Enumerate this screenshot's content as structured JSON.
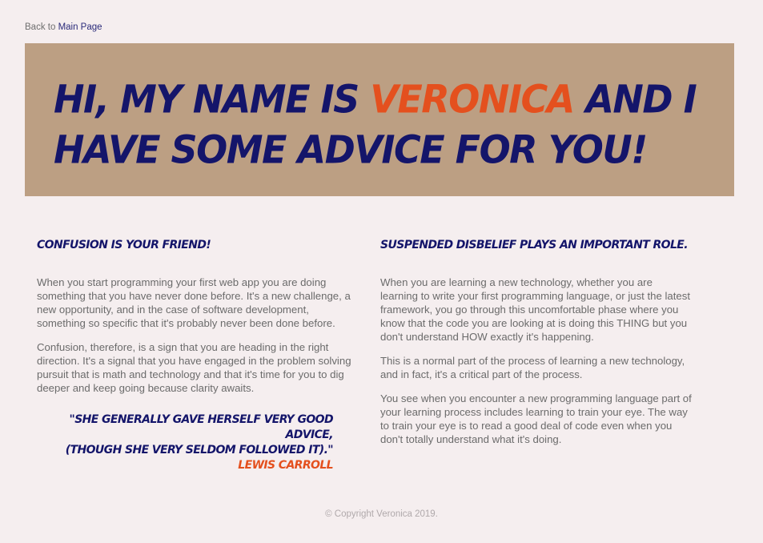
{
  "nav": {
    "back_prefix": "Back to",
    "back_link": "Main Page"
  },
  "hero": {
    "title_before": "Hi, my name is",
    "title_name": "Veronica",
    "title_after": "and I have some advice for you!"
  },
  "left": {
    "heading": "Confusion is your friend!",
    "paragraphs": [
      "When you start programming your first web app you are doing something that you have never done before. It's a new challenge, a new opportunity, and in the case of software development, something so specific that it's probably never been done before.",
      "Confusion, therefore, is a sign that you are heading in the right direction. It's a signal that you have engaged in the problem solving pursuit that is math and technology and that it's time for you to dig deeper and keep going because clarity awaits."
    ],
    "quote": {
      "line1": "\"She generally gave herself very good advice,",
      "line2": "(though she very seldom followed it).\"",
      "author": "Lewis Carroll"
    }
  },
  "right": {
    "heading": "Suspended disbelief plays an important role.",
    "paragraphs": [
      "When you are learning a new technology, whether you are learning to write your first programming language, or just the latest framework, you go through this uncomfortable phase where you know that the code you are looking at is doing this THING but you don't understand HOW exactly it's happening.",
      "This is a normal part of the process of learning a new technology, and in fact, it's a critical part of the process.",
      "You see when you encounter a new programming language part of your learning process includes learning to train your eye. The way to train your eye is to read a good deal of code even when you don't totally understand what it's doing."
    ]
  },
  "footer": {
    "text": "© Copyright Veronica 2019."
  },
  "colors": {
    "background": "#f5eeef",
    "hero_bg": "#bc9f83",
    "navy": "#14156a",
    "accent": "#e4501e",
    "body_text": "#6b6b6b"
  }
}
